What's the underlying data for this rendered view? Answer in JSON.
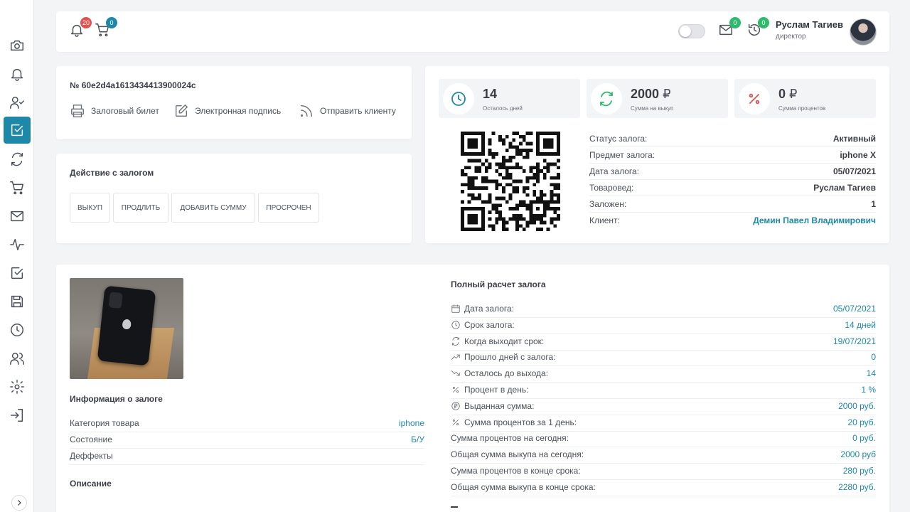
{
  "sidebar": {
    "items": [
      {
        "name": "camera-icon",
        "active": false
      },
      {
        "name": "bell-icon",
        "active": false
      },
      {
        "name": "user-check-icon",
        "active": false
      },
      {
        "name": "check-square-icon",
        "active": true
      },
      {
        "name": "refresh-icon",
        "active": false
      },
      {
        "name": "cart-icon",
        "active": false
      },
      {
        "name": "mail-icon",
        "active": false
      },
      {
        "name": "activity-icon",
        "active": false
      },
      {
        "name": "check-square-icon",
        "active": false
      },
      {
        "name": "save-icon",
        "active": false
      },
      {
        "name": "clock-icon",
        "active": false
      },
      {
        "name": "users-icon",
        "active": false
      },
      {
        "name": "settings-icon",
        "active": false
      },
      {
        "name": "login-icon",
        "active": false
      }
    ]
  },
  "header": {
    "notifications_count": "20",
    "cart_count": "0",
    "mail_count": "0",
    "history_count": "0",
    "user_name": "Руслам Тагиев",
    "user_role": "директор"
  },
  "ticket": {
    "number": "№ 60e2d4a1613434413900024c",
    "links": [
      "Залоговый билет",
      "Электронная подпись",
      "Отправить клиенту"
    ]
  },
  "actions": {
    "title": "Действие с залогом",
    "buttons": [
      "ВЫКУП",
      "ПРОДЛИТЬ",
      "ДОБАВИТЬ СУММУ",
      "ПРОСРОЧЕН"
    ]
  },
  "stats": [
    {
      "value": "14",
      "currency": "",
      "label": "Осталось дней",
      "icon": "clock-icon",
      "color": "#1e88a8"
    },
    {
      "value": "2000",
      "currency": "₽",
      "label": "Сумма на выкуп",
      "icon": "refresh-icon",
      "color": "#2dbb6b"
    },
    {
      "value": "0",
      "currency": "₽",
      "label": "Сумма процентов",
      "icon": "percent-icon",
      "color": "#e0524f"
    }
  ],
  "status_rows": [
    {
      "key": "Статус залога:",
      "value": "Активный"
    },
    {
      "key": "Предмет залога:",
      "value": "iphone X"
    },
    {
      "key": "Дата залога:",
      "value": "05/07/2021"
    },
    {
      "key": "Товаровед:",
      "value": "Руслам Тагиев"
    },
    {
      "key": "Заложен:",
      "value": "1"
    },
    {
      "key": "Клиент:",
      "value": "Демин Павел Владимирович"
    }
  ],
  "info": {
    "title": "Информация о залоге",
    "rows": [
      {
        "key": "Категория товара",
        "value": "iphone"
      },
      {
        "key": "Состояние",
        "value": "Б/У"
      },
      {
        "key": "Деффекты",
        "value": ""
      }
    ],
    "description_title": "Описание"
  },
  "calc": {
    "title": "Полный расчет залога",
    "rows": [
      {
        "icon": "calendar-icon",
        "key": "Дата залога:",
        "value": "05/07/2021"
      },
      {
        "icon": "clock-icon",
        "key": "Срок залога:",
        "value": "14 дней"
      },
      {
        "icon": "refresh-icon",
        "key": "Когда выходит срок:",
        "value": "19/07/2021"
      },
      {
        "icon": "trending-up-icon",
        "key": "Прошло дней с залога:",
        "value": "0"
      },
      {
        "icon": "trending-down-icon",
        "key": "Осталось до выхода:",
        "value": "14"
      },
      {
        "icon": "percent-icon",
        "key": "Процент в день:",
        "value": "1 %"
      },
      {
        "icon": "ruble-icon",
        "key": "Выданная сумма:",
        "value": "2000 руб."
      },
      {
        "icon": "percent-icon",
        "key": "Сумма процентов за 1 день:",
        "value": "20 руб."
      },
      {
        "icon": "",
        "key": "Сумма процентов на сегодня:",
        "value": "0 руб."
      },
      {
        "icon": "",
        "key": "Общая сумма выкупа на сегодня:",
        "value": "2000 руб"
      },
      {
        "icon": "",
        "key": "Сумма процентов в конце срока:",
        "value": "280 руб."
      },
      {
        "icon": "",
        "key": "Общая сумма выкупа в конце срока:",
        "value": "2280 руб."
      }
    ]
  }
}
